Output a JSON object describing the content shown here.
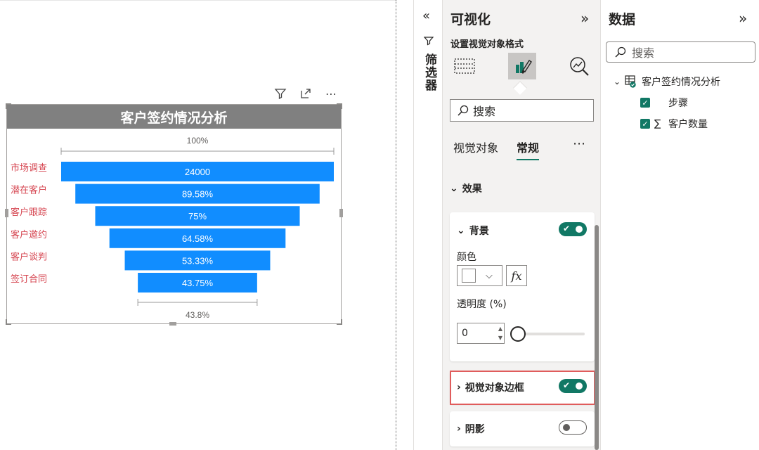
{
  "visual": {
    "title": "客户签约情况分析",
    "top_total_label": "100%",
    "bottom_total_label": "43.8%",
    "header_icons": [
      "filter-icon",
      "focus-mode-icon",
      "more-options-icon"
    ]
  },
  "chart_data": {
    "type": "funnel",
    "categories": [
      "市场调查",
      "潜在客户",
      "客户跟踪",
      "客户邀约",
      "客户谈判",
      "签订合同"
    ],
    "values": [
      24000,
      21500,
      18000,
      15500,
      12800,
      10500
    ],
    "data_labels": [
      "24000",
      "89.58%",
      "75%",
      "64.58%",
      "53.33%",
      "43.75%"
    ],
    "bar_color": "#118DFF",
    "category_label_color": "#D64550"
  },
  "filter_pane": {
    "label": "筛选器"
  },
  "viz_pane": {
    "title": "可视化",
    "subtitle": "设置视觉对象格式",
    "search_placeholder": "搜索",
    "subtabs": [
      "视觉对象",
      "常规"
    ],
    "effects_section": "效果",
    "background": {
      "label": "背景",
      "color_label": "颜色",
      "fx_label": "fx",
      "transparency_label": "透明度 (%)",
      "transparency_value": "0",
      "enabled": true
    },
    "visual_border": {
      "label": "视觉对象边框",
      "enabled": true
    },
    "shadow": {
      "label": "阴影",
      "enabled": false
    }
  },
  "data_pane": {
    "title": "数据",
    "search_placeholder": "搜索",
    "table_name": "客户签约情况分析",
    "fields": [
      {
        "name": "步骤",
        "sigma": "",
        "checked": true
      },
      {
        "name": "客户数量",
        "sigma": "∑",
        "checked": true
      }
    ]
  },
  "colors": {
    "accent": "#117865",
    "highlight_border": "#E05C5C"
  }
}
